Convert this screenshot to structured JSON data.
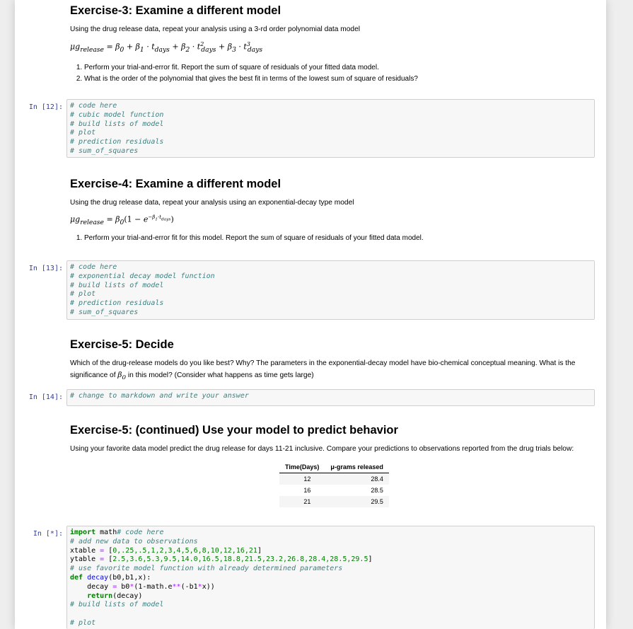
{
  "ex3": {
    "title": "Exercise-3: Examine a different model",
    "intro": "Using the drug release data, repeat your analysis using a 3-rd order polynomial data model",
    "items": [
      "Perform your trial-and-error fit. Report the sum of square of residuals of your fitted data model.",
      "What is the order of the polynomial that gives the best fit in terms of the lowest sum of square of residuals?"
    ]
  },
  "cell12": {
    "prompt": "In [12]:",
    "lines": [
      "# code here",
      "# cubic model function",
      "# build lists of model",
      "# plot",
      "# prediction residuals",
      "# sum_of_squares"
    ]
  },
  "ex4": {
    "title": "Exercise-4: Examine a different model",
    "intro": "Using the drug release data, repeat your analysis using an exponential-decay type model",
    "items": [
      "Perform your trial-and-error fit for this model. Report the sum of square of residuals of your fitted data model."
    ]
  },
  "cell13": {
    "prompt": "In [13]:",
    "lines": [
      "# code here",
      "# exponential decay model function",
      "# build lists of model",
      "# plot",
      "# prediction residuals",
      "# sum_of_squares"
    ]
  },
  "ex5": {
    "title": "Exercise-5: Decide",
    "text1": "Which of the drug-release models do you like best? Why? The parameters in the exponential-decay model have bio-chemical conceptual meaning. What is the",
    "text2a": "significance of ",
    "text2b": " in this model? (Consider what happens as time gets large)"
  },
  "cell14": {
    "prompt": "In [14]:",
    "line": "# change to markdown and write your answer"
  },
  "ex5b": {
    "title": "Exercise-5: (continued) Use your model to predict behavior",
    "intro": "Using your favorite data model predict the drug release for days 11-21 inclusive. Compare your predictions to observations reported from the drug trials below:"
  },
  "table": {
    "headers": [
      "Time(Days)",
      "μ-grams released"
    ],
    "rows": [
      [
        "12",
        "28.4"
      ],
      [
        "16",
        "28.5"
      ],
      [
        "21",
        "29.5"
      ]
    ]
  },
  "cellstar": {
    "prompt": "In [*]:",
    "l1_kw": "import",
    "l1_mod": " math",
    "l1_c": "# code here",
    "l2": "# add new data to observations",
    "l3_a": "xtable ",
    "l3_eq": "=",
    "l3_b": " [",
    "l3_vals": "0,.25,.5,1,2,3,4,5,6,8,10,12,16,21",
    "l3_end": "]",
    "l4_a": "ytable ",
    "l4_eq": "=",
    "l4_b": " [",
    "l4_vals": "2.5,3.6,5.3,9.5,14.0,16.5,18.8,21.5,23.2,26.8,28.4,28.5,29.5",
    "l4_end": "]",
    "l5": "# use favorite model function with already determined parameters",
    "l6_kw": "def",
    "l6_sp": " ",
    "l6_fn": "decay",
    "l6_args": "(b0,b1,x):",
    "l7_a": "    decay ",
    "l7_eq": "=",
    "l7_b": " b0",
    "l7_mul": "*",
    "l7_c": "(1-math.e",
    "l7_pow": "**",
    "l7_d": "(-b1",
    "l7_mul2": "*",
    "l7_e": "x))",
    "l8_kw": "    return",
    "l8_rest": "(decay)",
    "l9": "# build lists of model",
    "l10": "",
    "l11": "# plot"
  }
}
